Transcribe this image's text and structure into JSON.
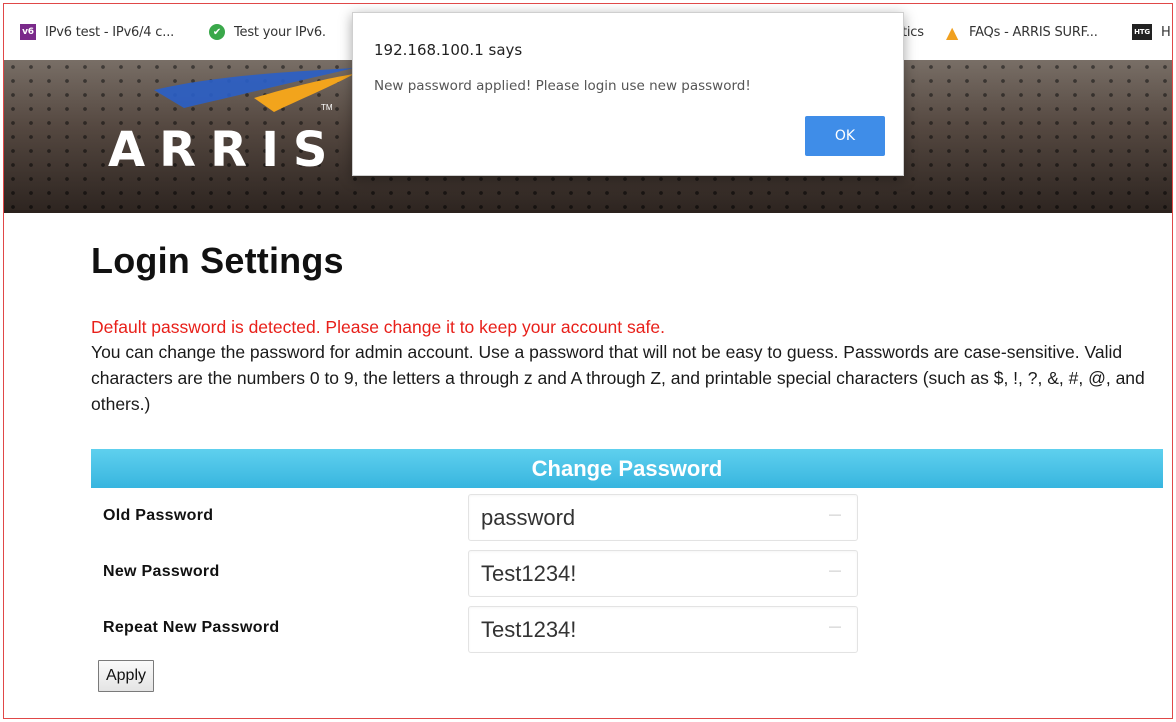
{
  "bookmarks": [
    {
      "label": "IPv6 test - IPv6/4 c...",
      "icon": "ipv6-logo-icon",
      "icon_text": "v6",
      "color": "#7a2a8a"
    },
    {
      "label": "Test your IPv6.",
      "icon": "green-check-icon",
      "icon_text": "✔",
      "color": "#3aa84a"
    },
    {
      "label": "tics",
      "icon": "",
      "icon_text": "",
      "color": ""
    },
    {
      "label": "FAQs - ARRIS SURF...",
      "icon": "arris-logo-icon",
      "icon_text": "▲",
      "color": "#f0a020"
    },
    {
      "label": "H",
      "icon": "htg-logo-icon",
      "icon_text": "HTG",
      "color": "#222222"
    }
  ],
  "header": {
    "brand": "ARRIS",
    "trademark": "TM"
  },
  "page": {
    "title": "Login Settings",
    "warning": "Default password is detected. Please change it to keep your account safe.",
    "description": "You can change the password for admin account. Use a password that will not be easy to guess. Passwords are case-sensitive. Valid characters are the numbers 0 to 9, the letters a through z and A through Z, and printable special characters (such as $, !, ?, &, #, @, and others.)"
  },
  "change_password": {
    "heading": "Change Password",
    "fields": [
      {
        "label": "Old Password",
        "value": "password"
      },
      {
        "label": "New Password",
        "value": "Test1234!"
      },
      {
        "label": "Repeat New Password",
        "value": "Test1234!"
      }
    ],
    "apply_label": "Apply"
  },
  "dialog": {
    "title": "192.168.100.1 says",
    "message": "New password applied! Please login use new password!",
    "ok_label": "OK"
  },
  "colors": {
    "warning": "#e8201a",
    "table_header": "#37b5df",
    "ok_button": "#3f8de8",
    "frame_border": "#e04848"
  }
}
